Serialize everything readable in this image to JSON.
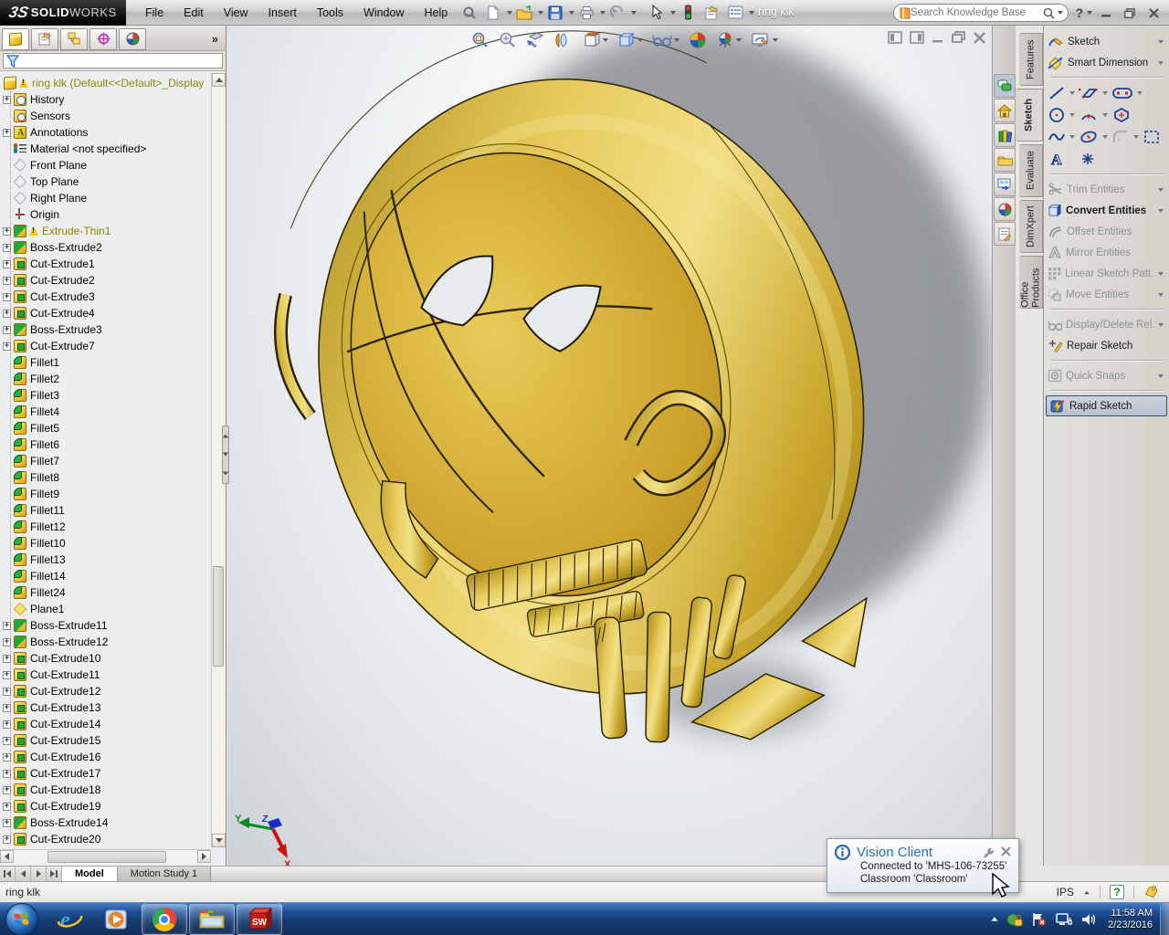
{
  "window": {
    "app_prefix": "3S",
    "app_bold": "SOLID",
    "app_light": "WORKS",
    "title": "ring klk"
  },
  "menubar": {
    "items": [
      "File",
      "Edit",
      "View",
      "Insert",
      "Tools",
      "Window",
      "Help"
    ]
  },
  "search": {
    "placeholder": "Search Knowledge Base"
  },
  "feature_tree": {
    "root": "ring klk  (Default<<Default>_Display",
    "items": [
      {
        "label": "History",
        "icon": "history",
        "flags": "x"
      },
      {
        "label": "Sensors",
        "icon": "sensors",
        "flags": ""
      },
      {
        "label": "Annotations",
        "icon": "annotations",
        "flags": "x"
      },
      {
        "label": "Material <not specified>",
        "icon": "material",
        "flags": ""
      },
      {
        "label": "Front Plane",
        "icon": "plane",
        "flags": ""
      },
      {
        "label": "Top Plane",
        "icon": "plane",
        "flags": ""
      },
      {
        "label": "Right Plane",
        "icon": "plane",
        "flags": ""
      },
      {
        "label": "Origin",
        "icon": "origin",
        "flags": ""
      },
      {
        "label": "Extrude-Thin1",
        "icon": "boss",
        "flags": "x w o"
      },
      {
        "label": "Boss-Extrude2",
        "icon": "boss",
        "flags": "x"
      },
      {
        "label": "Cut-Extrude1",
        "icon": "cut",
        "flags": "x"
      },
      {
        "label": "Cut-Extrude2",
        "icon": "cut",
        "flags": "x"
      },
      {
        "label": "Cut-Extrude3",
        "icon": "cut",
        "flags": "x"
      },
      {
        "label": "Cut-Extrude4",
        "icon": "cut",
        "flags": "x"
      },
      {
        "label": "Boss-Extrude3",
        "icon": "boss",
        "flags": "x"
      },
      {
        "label": "Cut-Extrude7",
        "icon": "cut",
        "flags": "x"
      },
      {
        "label": "Fillet1",
        "icon": "fillet",
        "flags": ""
      },
      {
        "label": "Fillet2",
        "icon": "fillet",
        "flags": ""
      },
      {
        "label": "Fillet3",
        "icon": "fillet",
        "flags": ""
      },
      {
        "label": "Fillet4",
        "icon": "fillet",
        "flags": ""
      },
      {
        "label": "Fillet5",
        "icon": "fillet",
        "flags": ""
      },
      {
        "label": "Fillet6",
        "icon": "fillet",
        "flags": ""
      },
      {
        "label": "Fillet7",
        "icon": "fillet",
        "flags": ""
      },
      {
        "label": "Fillet8",
        "icon": "fillet",
        "flags": ""
      },
      {
        "label": "Fillet9",
        "icon": "fillet",
        "flags": ""
      },
      {
        "label": "Fillet11",
        "icon": "fillet",
        "flags": ""
      },
      {
        "label": "Fillet12",
        "icon": "fillet",
        "flags": ""
      },
      {
        "label": "Fillet10",
        "icon": "fillet",
        "flags": ""
      },
      {
        "label": "Fillet13",
        "icon": "fillet",
        "flags": ""
      },
      {
        "label": "Fillet14",
        "icon": "fillet",
        "flags": ""
      },
      {
        "label": "Fillet24",
        "icon": "fillet",
        "flags": ""
      },
      {
        "label": "Plane1",
        "icon": "plane1",
        "flags": ""
      },
      {
        "label": "Boss-Extrude11",
        "icon": "boss",
        "flags": "x"
      },
      {
        "label": "Boss-Extrude12",
        "icon": "boss",
        "flags": "x"
      },
      {
        "label": "Cut-Extrude10",
        "icon": "cut",
        "flags": "x"
      },
      {
        "label": "Cut-Extrude11",
        "icon": "cut",
        "flags": "x"
      },
      {
        "label": "Cut-Extrude12",
        "icon": "cut",
        "flags": "x"
      },
      {
        "label": "Cut-Extrude13",
        "icon": "cut",
        "flags": "x"
      },
      {
        "label": "Cut-Extrude14",
        "icon": "cut",
        "flags": "x"
      },
      {
        "label": "Cut-Extrude15",
        "icon": "cut",
        "flags": "x"
      },
      {
        "label": "Cut-Extrude16",
        "icon": "cut",
        "flags": "x"
      },
      {
        "label": "Cut-Extrude17",
        "icon": "cut",
        "flags": "x"
      },
      {
        "label": "Cut-Extrude18",
        "icon": "cut",
        "flags": "x"
      },
      {
        "label": "Cut-Extrude19",
        "icon": "cut",
        "flags": "x"
      },
      {
        "label": "Boss-Extrude14",
        "icon": "boss",
        "flags": "x"
      },
      {
        "label": "Cut-Extrude20",
        "icon": "cut",
        "flags": "x"
      },
      {
        "label": "",
        "icon": "boss",
        "flags": "x"
      }
    ]
  },
  "command_tabs": {
    "items": [
      {
        "label": "Features",
        "flags": ""
      },
      {
        "label": "Sketch",
        "flags": "active"
      },
      {
        "label": "Evaluate",
        "flags": ""
      },
      {
        "label": "DimXpert",
        "flags": ""
      },
      {
        "label": "Office Products",
        "flags": ""
      }
    ]
  },
  "command_panel": {
    "items": [
      {
        "label": "Sketch"
      },
      {
        "label": "Smart Dimension"
      },
      {
        "label": "Trim Entities"
      },
      {
        "label": "Convert Entities"
      },
      {
        "label": "Offset Entities"
      },
      {
        "label": "Mirror Entities"
      },
      {
        "label": "Linear Sketch Patt..."
      },
      {
        "label": "Move Entities"
      },
      {
        "label": "Display/Delete Rel..."
      },
      {
        "label": "Repair Sketch"
      },
      {
        "label": "Quick Snaps"
      },
      {
        "label": "Rapid Sketch"
      }
    ]
  },
  "bottom_bar": {
    "tabs": [
      {
        "label": "Model"
      },
      {
        "label": "Motion Study 1"
      }
    ]
  },
  "status": {
    "document": "ring klk",
    "units": "IPS"
  },
  "popup": {
    "title": "Vision Client",
    "line1": "Connected to 'MHS-106-73255'",
    "line2": "Classroom 'Classroom'"
  },
  "taskbar": {
    "time": "11:58 AM",
    "date": "2/23/2016"
  },
  "viewport": {
    "triad": {
      "x": "X",
      "y": "Y",
      "z": "Z"
    }
  },
  "colors": {
    "gold": "#c9a42c",
    "gold_light": "#f2df86",
    "gold_dark": "#8d7110",
    "shadow": "#3f4349",
    "accent_blue": "#2d6fb5",
    "taskbar_blue": "#1f4f97"
  }
}
